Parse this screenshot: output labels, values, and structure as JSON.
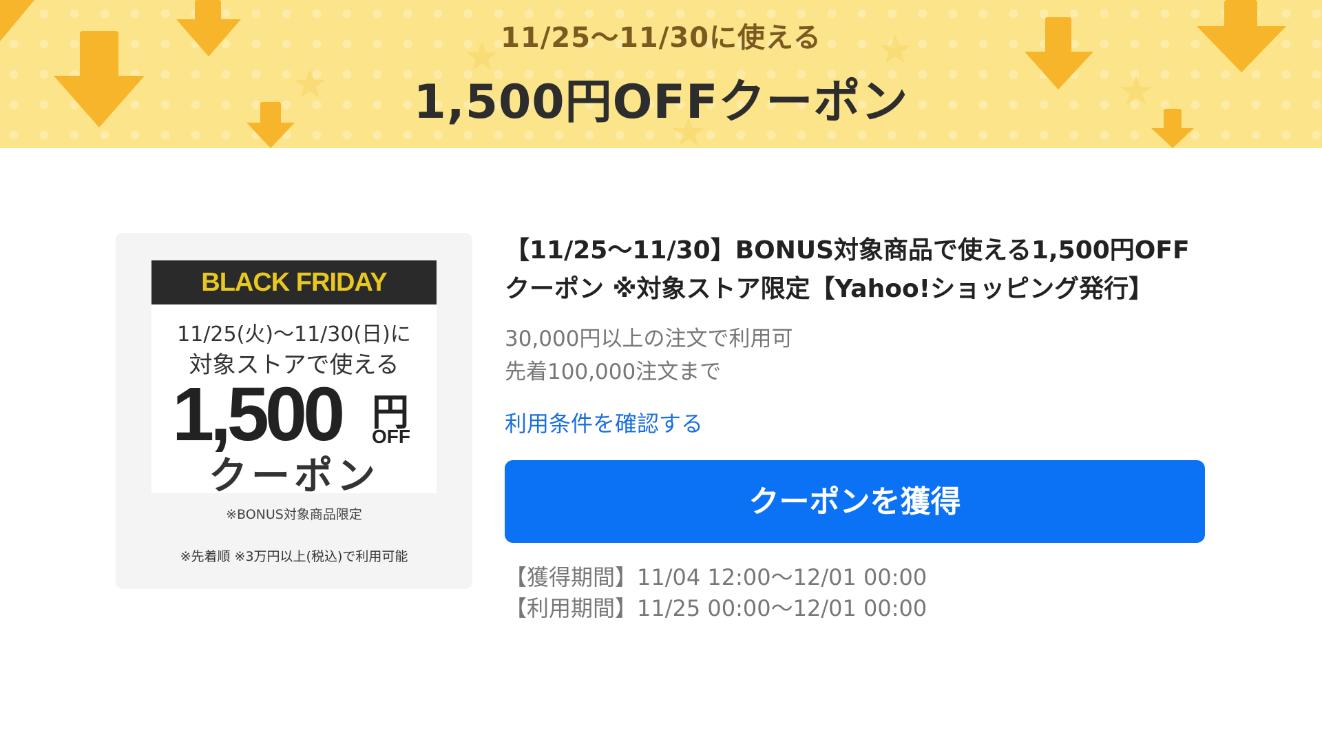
{
  "banner": {
    "subtitle": "11/25〜11/30に使える",
    "title": "1,500円OFFクーポン",
    "bg_color": "#fce48a",
    "arrow_color": "#f6b52a"
  },
  "coupon_image": {
    "event": "BLACK FRIDAY",
    "dates": "11/25(火)〜11/30(日)に",
    "store_text": "対象ストアで使える",
    "amount": "1,500",
    "yen": "円",
    "off": "OFF",
    "coupon_word": "クーポン",
    "limited": "※BONUS対象商品限定",
    "note": "※先着順 ※3万円以上(税込)で利用可能"
  },
  "details": {
    "title": "【11/25〜11/30】BONUS対象商品で使える1,500円OFFクーポン ※対象ストア限定【Yahoo!ショッピング発行】",
    "condition_min": "30,000円以上の注文で利用可",
    "condition_limit": "先着100,000注文まで",
    "terms_link": "利用条件を確認する",
    "get_button": "クーポンを獲得",
    "acquire_period": "【獲得期間】11/04 12:00〜12/01 00:00",
    "use_period": "【利用期間】11/25 00:00〜12/01 00:00",
    "button_color": "#0b72f5",
    "link_color": "#1a6fe0"
  }
}
